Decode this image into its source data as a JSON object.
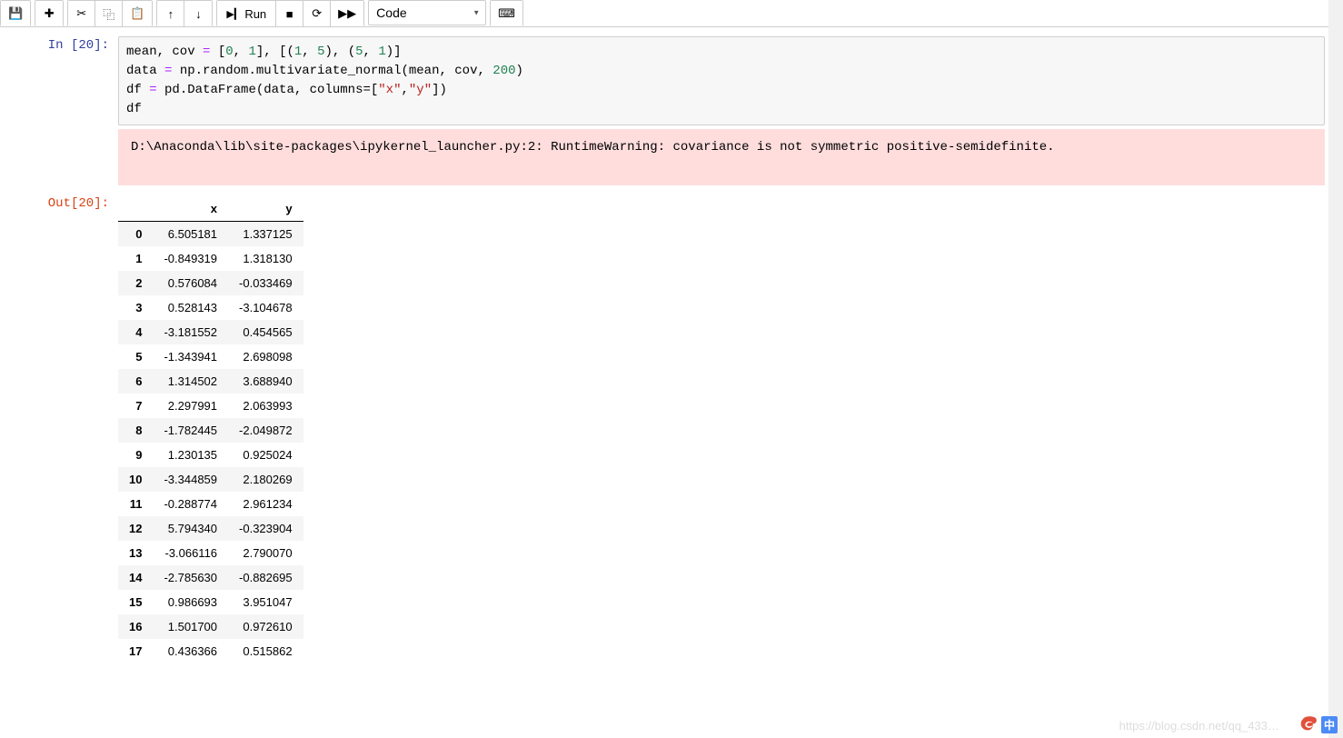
{
  "toolbar": {
    "save": "💾",
    "insert": "✚",
    "cut": "✂",
    "copy": "⿻",
    "paste": "📋",
    "up": "↑",
    "down": "↓",
    "run_icon": "▶▎",
    "run_label": "Run",
    "stop": "■",
    "restart": "⟳",
    "restart_run": "▶▶",
    "cell_type": "Code",
    "cmd_palette": "⌨"
  },
  "cell": {
    "in_prompt": "In  [20]:",
    "out_prompt": "Out[20]:",
    "code_tokens": {
      "l1": {
        "a": "mean, cov",
        "eq": " = ",
        "b": "[",
        "n0": "0",
        "c1": ", ",
        "n1": "1",
        "d": "], [(",
        "n2": "1",
        "c2": ", ",
        "n3": "5",
        "e": "), (",
        "n4": "5",
        "c3": ", ",
        "n5": "1",
        "f": ")]"
      },
      "l2": {
        "a": "data",
        "eq": " = ",
        "b": "np.random.multivariate_normal(mean, cov, ",
        "n": "200",
        "c": ")"
      },
      "l3": {
        "a": "df",
        "eq": " = ",
        "b": "pd.DataFrame(data, columns=[",
        "s1": "\"x\"",
        "c1": ",",
        "s2": "\"y\"",
        "c2": "])"
      },
      "l4": {
        "a": "df"
      }
    },
    "warning": "D:\\Anaconda\\lib\\site-packages\\ipykernel_launcher.py:2: RuntimeWarning: covariance is not symmetric positive-semidefinite.\n  ",
    "table": {
      "blank": "",
      "cols": [
        "x",
        "y"
      ],
      "rows": [
        {
          "i": "0",
          "x": "6.505181",
          "y": "1.337125"
        },
        {
          "i": "1",
          "x": "-0.849319",
          "y": "1.318130"
        },
        {
          "i": "2",
          "x": "0.576084",
          "y": "-0.033469"
        },
        {
          "i": "3",
          "x": "0.528143",
          "y": "-3.104678"
        },
        {
          "i": "4",
          "x": "-3.181552",
          "y": "0.454565"
        },
        {
          "i": "5",
          "x": "-1.343941",
          "y": "2.698098"
        },
        {
          "i": "6",
          "x": "1.314502",
          "y": "3.688940"
        },
        {
          "i": "7",
          "x": "2.297991",
          "y": "2.063993"
        },
        {
          "i": "8",
          "x": "-1.782445",
          "y": "-2.049872"
        },
        {
          "i": "9",
          "x": "1.230135",
          "y": "0.925024"
        },
        {
          "i": "10",
          "x": "-3.344859",
          "y": "2.180269"
        },
        {
          "i": "11",
          "x": "-0.288774",
          "y": "2.961234"
        },
        {
          "i": "12",
          "x": "5.794340",
          "y": "-0.323904"
        },
        {
          "i": "13",
          "x": "-3.066116",
          "y": "2.790070"
        },
        {
          "i": "14",
          "x": "-2.785630",
          "y": "-0.882695"
        },
        {
          "i": "15",
          "x": "0.986693",
          "y": "3.951047"
        },
        {
          "i": "16",
          "x": "1.501700",
          "y": "0.972610"
        },
        {
          "i": "17",
          "x": "0.436366",
          "y": "0.515862"
        }
      ]
    }
  },
  "corner": {
    "badge": "中"
  },
  "watermark": "https://blog.csdn.net/qq_433…"
}
